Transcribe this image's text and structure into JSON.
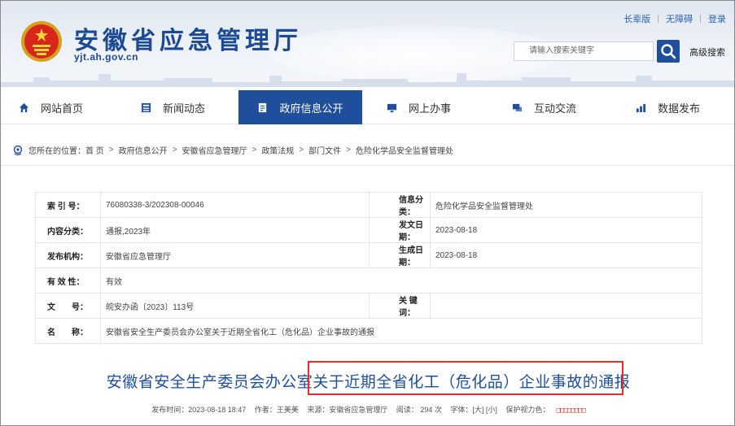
{
  "header": {
    "site_title": "安徽省应急管理厅",
    "site_url": "yjt.ah.gov.cn",
    "top_links": [
      "长辈版",
      "无障碍",
      "登录"
    ],
    "search_placeholder": "请输入搜索关键字",
    "advanced_search": "高级搜索"
  },
  "nav": {
    "items": [
      {
        "label": "网站首页",
        "icon": "home-icon"
      },
      {
        "label": "新闻动态",
        "icon": "news-icon"
      },
      {
        "label": "政府信息公开",
        "icon": "document-icon",
        "active": true
      },
      {
        "label": "网上办事",
        "icon": "monitor-icon"
      },
      {
        "label": "互动交流",
        "icon": "chat-icon"
      },
      {
        "label": "数据发布",
        "icon": "chart-icon"
      }
    ]
  },
  "breadcrumb": {
    "prefix": "您所在的位置：",
    "items": [
      "首 页",
      "政府信息公开",
      "安徽省应急管理厅",
      "政策法规",
      "部门文件",
      "危险化学品安全监督管理处"
    ]
  },
  "info": {
    "index_no_label": "索 引 号：",
    "index_no": "76080338-3/202308-00046",
    "info_category_label": "信息分类：",
    "info_category": "危险化学品安全监督管理处",
    "content_category_label": "内容分类：",
    "content_category": "通报,2023年",
    "issue_date_label": "发文日期：",
    "issue_date": "2023-08-18",
    "publisher_label": "发布机构：",
    "publisher": "安徽省应急管理厅",
    "effective_date_label": "生成日期：",
    "effective_date": "2023-08-18",
    "validity_label": "有 效 性：",
    "validity": "有效",
    "doc_no_label": "文　　号：",
    "doc_no": "皖安办函〔2023〕113号",
    "keywords_label": "关 键 词：",
    "keywords": "",
    "name_label": "名　　称：",
    "name": "安徽省安全生产委员会办公室关于近期全省化工（危化品）企业事故的通报"
  },
  "article": {
    "title": "安徽省安全生产委员会办公室关于近期全省化工（危化品）企业事故的通报",
    "publish_time": "发布时间：2023-08-18 18:47",
    "author": "作者：王美美",
    "source": "来源：安徽省应急管理厅",
    "reads": "阅读： 294 次",
    "font_size": "字体：[大] [小]",
    "eye_protection": "保护视力色：",
    "eye_boxes": "□□□□□□□□"
  },
  "colors": {
    "brand_blue": "#1f4f9c",
    "highlight_red": "#e0302a"
  }
}
